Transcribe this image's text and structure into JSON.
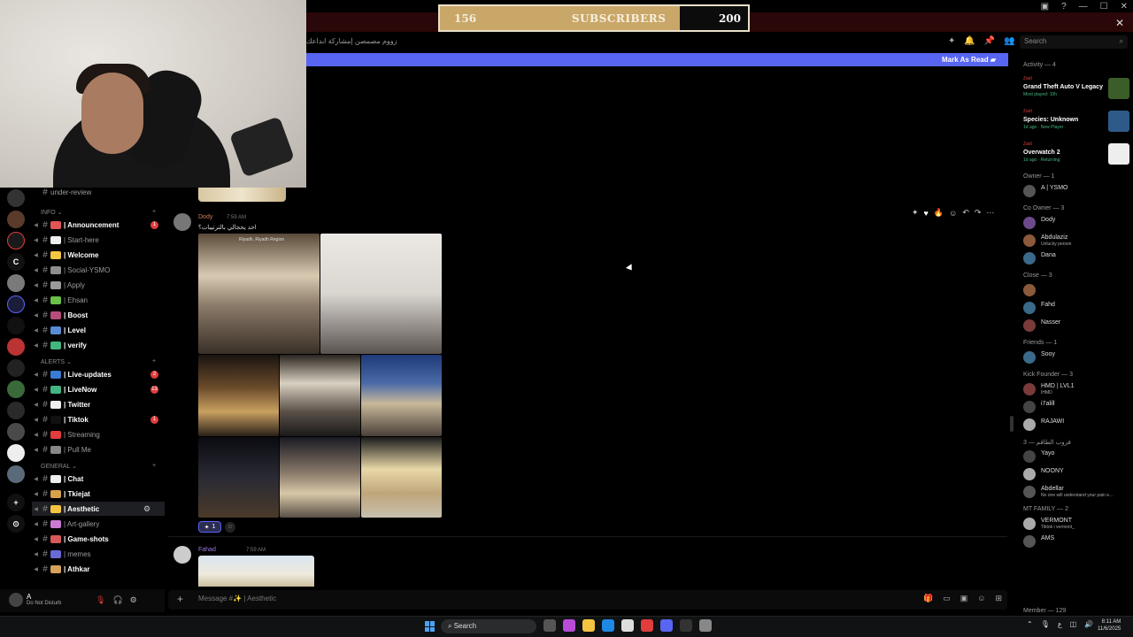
{
  "stream_overlay": {
    "subscribers_current": "156",
    "subscribers_label": "SUBSCRIBERS",
    "subscribers_goal": "200",
    "progress_fraction": 0.78
  },
  "header": {
    "topic": "زووم مصمصن إمشاركة ابداعك",
    "search_placeholder": "Search",
    "new_messages_button": "Mark As Read"
  },
  "sidebar": {
    "truncated_top": "under-review",
    "categories": [
      {
        "label": "INFO",
        "channels": [
          {
            "name": "| Announcement",
            "bold": true,
            "badge": "1",
            "color": "#e25555"
          },
          {
            "name": "| Start-here",
            "bold": false,
            "color": "#eeeeee"
          },
          {
            "name": "| Welcome",
            "bold": true,
            "color": "#f5c542"
          },
          {
            "name": "| Social-YSMO",
            "bold": false,
            "color": "#8e8e8e"
          },
          {
            "name": "| Apply",
            "bold": false,
            "color": "#9b9b9b"
          },
          {
            "name": "| Ehsan",
            "bold": false,
            "color": "#6cc04a"
          },
          {
            "name": "| Boost",
            "bold": true,
            "color": "#b84c7c"
          },
          {
            "name": "| Level",
            "bold": true,
            "color": "#5a8bd6"
          },
          {
            "name": "| verify",
            "bold": true,
            "color": "#43b581"
          }
        ]
      },
      {
        "label": "ALERTS",
        "channels": [
          {
            "name": "| Live-updates",
            "bold": true,
            "badge": "2",
            "color": "#3a7bd5"
          },
          {
            "name": "| LiveNow",
            "bold": true,
            "badge": "13",
            "color": "#43b581"
          },
          {
            "name": "| Twitter",
            "bold": true,
            "color": "#eeeeee"
          },
          {
            "name": "| Tiktok",
            "bold": true,
            "badge": "1",
            "color": "#111111"
          },
          {
            "name": "| Streaming",
            "bold": false,
            "color": "#e23d3d"
          },
          {
            "name": "| Pull Me",
            "bold": false,
            "color": "#888888"
          }
        ]
      },
      {
        "label": "GENERAL",
        "channels": [
          {
            "name": "| Chat",
            "bold": true,
            "color": "#eeeeee"
          },
          {
            "name": "| Tkiejat",
            "bold": true,
            "color": "#d8a24a"
          },
          {
            "name": "| Aesthetic",
            "bold": true,
            "active": true,
            "color": "#f5c542"
          },
          {
            "name": "| Art-gallery",
            "bold": false,
            "color": "#c97bd1"
          },
          {
            "name": "| Game-shots",
            "bold": true,
            "color": "#d65a5a"
          },
          {
            "name": "| memes",
            "bold": false,
            "color": "#6a6ad6"
          },
          {
            "name": "| Athkar",
            "bold": true,
            "color": "#d6a15a"
          }
        ]
      }
    ]
  },
  "user_panel": {
    "name": "A",
    "status": "Do Not Disturb"
  },
  "messages": [
    {
      "author": "Dody",
      "time": "7:59 AM",
      "text": "احد يحجالي بالترتيبات؟",
      "image_caption": "Riyadh, Riyadh Region",
      "reaction_count": "1"
    },
    {
      "author": "Fahad",
      "time": "7:59 AM"
    }
  ],
  "composer": {
    "placeholder": "Message #✨ | Aesthetic"
  },
  "members": {
    "activity_header": "Activity — 4",
    "activities": [
      {
        "user": "Zaid",
        "game": "Grand Theft Auto V Legacy",
        "sub": "Most played: 10h",
        "thumb": "#3b5d2a"
      },
      {
        "user": "Zaid",
        "game": "Species: Unknown",
        "sub": "1d ago · New Player",
        "thumb": "#2e5a8a"
      },
      {
        "user": "Zaid",
        "game": "Overwatch 2",
        "sub": "1d ago · Returning",
        "thumb": "#eeeeee"
      }
    ],
    "groups": [
      {
        "label": "Owner — 1",
        "members": [
          {
            "name": "A | YSMO",
            "sub": ""
          }
        ]
      },
      {
        "label": "Co Owner — 3",
        "members": [
          {
            "name": "Dody",
            "sub": ""
          },
          {
            "name": "Abdulaziz",
            "sub": "Unlucky person"
          },
          {
            "name": "Dana",
            "sub": ""
          }
        ]
      },
      {
        "label": "Close — 3",
        "members": [
          {
            "name": "",
            "sub": ""
          },
          {
            "name": "Fahd",
            "sub": ""
          },
          {
            "name": "Nasser",
            "sub": ""
          }
        ]
      },
      {
        "label": "Friends — 1",
        "members": [
          {
            "name": "Sooy",
            "sub": ""
          }
        ]
      },
      {
        "label": "Kick Founder — 3",
        "members": [
          {
            "name": "HMD | LVL1",
            "sub": "IHMD"
          },
          {
            "name": "i7alill",
            "sub": ""
          },
          {
            "name": "RAJAWI",
            "sub": ""
          }
        ]
      },
      {
        "label": "قروب الطاقم — 3",
        "members": [
          {
            "name": "Yayo",
            "sub": ""
          },
          {
            "name": "NOONY",
            "sub": ""
          },
          {
            "name": "Abdellar",
            "sub": "No one will understand your pain e..."
          }
        ]
      },
      {
        "label": "MT FAMILY — 2",
        "members": [
          {
            "name": "VERMONT",
            "sub": "Tiktok i vermont_"
          },
          {
            "name": "AMS",
            "sub": ""
          }
        ]
      }
    ],
    "footer": "Member — 129"
  },
  "taskbar": {
    "search": "Search",
    "time": "8:11 AM",
    "date": "11/6/2025"
  }
}
